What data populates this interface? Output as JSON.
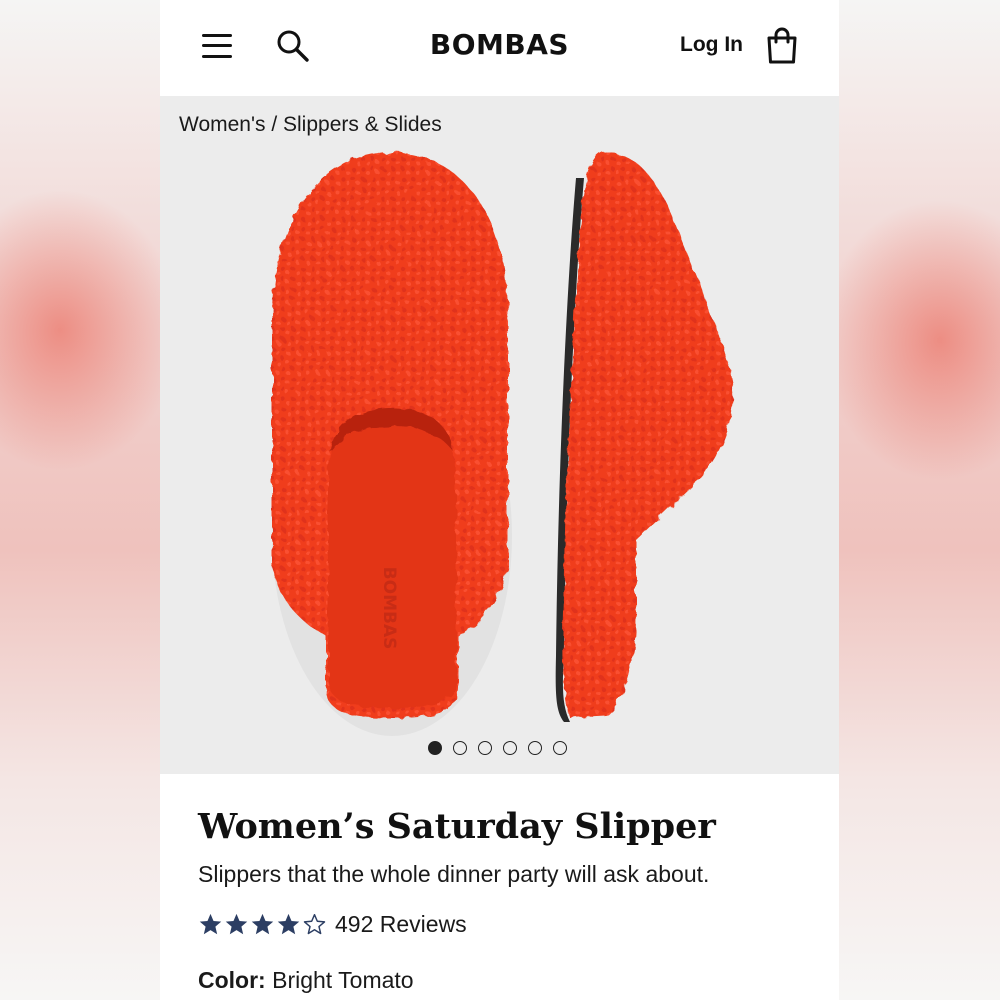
{
  "header": {
    "logo": "BOMBAS",
    "login_label": "Log In"
  },
  "breadcrumb": {
    "items": [
      "Women's",
      "Slippers & Slides"
    ],
    "separator": " / "
  },
  "gallery": {
    "slide_count": 6,
    "active_slide": 1,
    "product_color": "#f03d1c",
    "sole_color": "#2a2a2a",
    "insole_logo": "BOMBAS"
  },
  "product": {
    "title": "Women’s Saturday Slipper",
    "subtitle": "Slippers that the whole dinner party will ask about.",
    "rating": 4,
    "rating_max": 5,
    "reviews_label": "492 Reviews",
    "color_label": "Color:",
    "color_value": "Bright Tomato",
    "star_color": "#2c3e63"
  }
}
